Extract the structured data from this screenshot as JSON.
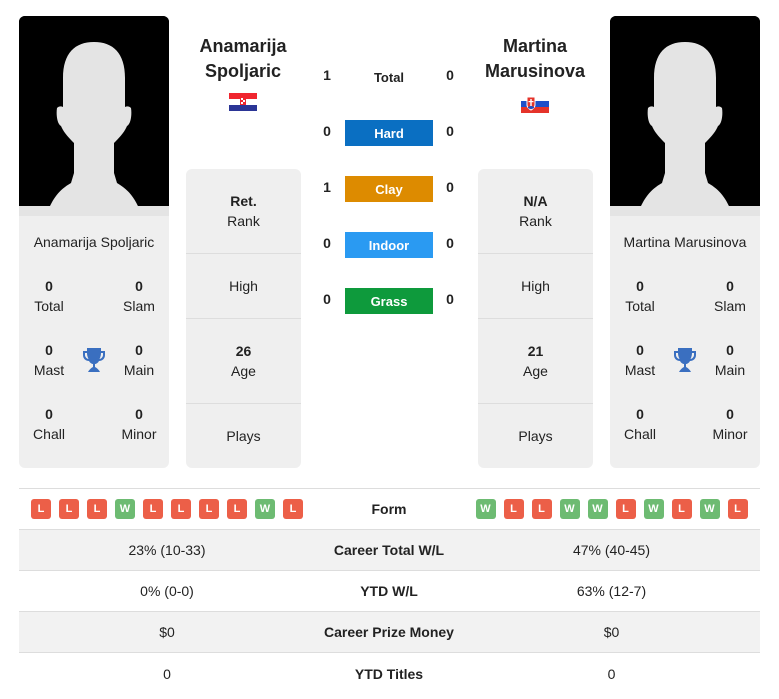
{
  "player1": {
    "name_line1": "Anamarija",
    "name_line2": "Spoljaric",
    "full_name": "Anamarija Spoljaric",
    "flag": "croatia-flag",
    "titles": {
      "total": "0",
      "slam": "0",
      "mast": "0",
      "main": "0",
      "chall": "0",
      "minor": "0"
    },
    "rank_value": "Ret.",
    "high_value": "",
    "age_value": "26",
    "plays_value": "",
    "form": [
      "L",
      "L",
      "L",
      "W",
      "L",
      "L",
      "L",
      "L",
      "W",
      "L"
    ],
    "career_total_wl": "23% (10-33)",
    "ytd_wl": "0% (0-0)",
    "career_prize_money": "$0",
    "ytd_titles": "0"
  },
  "player2": {
    "name_line1": "Martina",
    "name_line2": "Marusinova",
    "full_name": "Martina Marusinova",
    "flag": "slovakia-flag",
    "titles": {
      "total": "0",
      "slam": "0",
      "mast": "0",
      "main": "0",
      "chall": "0",
      "minor": "0"
    },
    "rank_value": "N/A",
    "high_value": "",
    "age_value": "21",
    "plays_value": "",
    "form": [
      "W",
      "L",
      "L",
      "W",
      "W",
      "L",
      "W",
      "L",
      "W",
      "L"
    ],
    "career_total_wl": "47% (40-45)",
    "ytd_wl": "63% (12-7)",
    "career_prize_money": "$0",
    "ytd_titles": "0"
  },
  "labels": {
    "total": "Total",
    "slam": "Slam",
    "mast": "Mast",
    "main": "Main",
    "chall": "Chall",
    "minor": "Minor",
    "rank": "Rank",
    "high": "High",
    "age": "Age",
    "plays": "Plays",
    "form": "Form",
    "career_total_wl": "Career Total W/L",
    "ytd_wl": "YTD W/L",
    "career_prize_money": "Career Prize Money",
    "ytd_titles": "YTD Titles"
  },
  "h2h": [
    {
      "label": "Total",
      "p1": "1",
      "p2": "0",
      "color": ""
    },
    {
      "label": "Hard",
      "p1": "0",
      "p2": "0",
      "color": "#0a6fc2"
    },
    {
      "label": "Clay",
      "p1": "1",
      "p2": "0",
      "color": "#dd8b00"
    },
    {
      "label": "Indoor",
      "p1": "0",
      "p2": "0",
      "color": "#2a9af2"
    },
    {
      "label": "Grass",
      "p1": "0",
      "p2": "0",
      "color": "#0e9a3c"
    }
  ]
}
